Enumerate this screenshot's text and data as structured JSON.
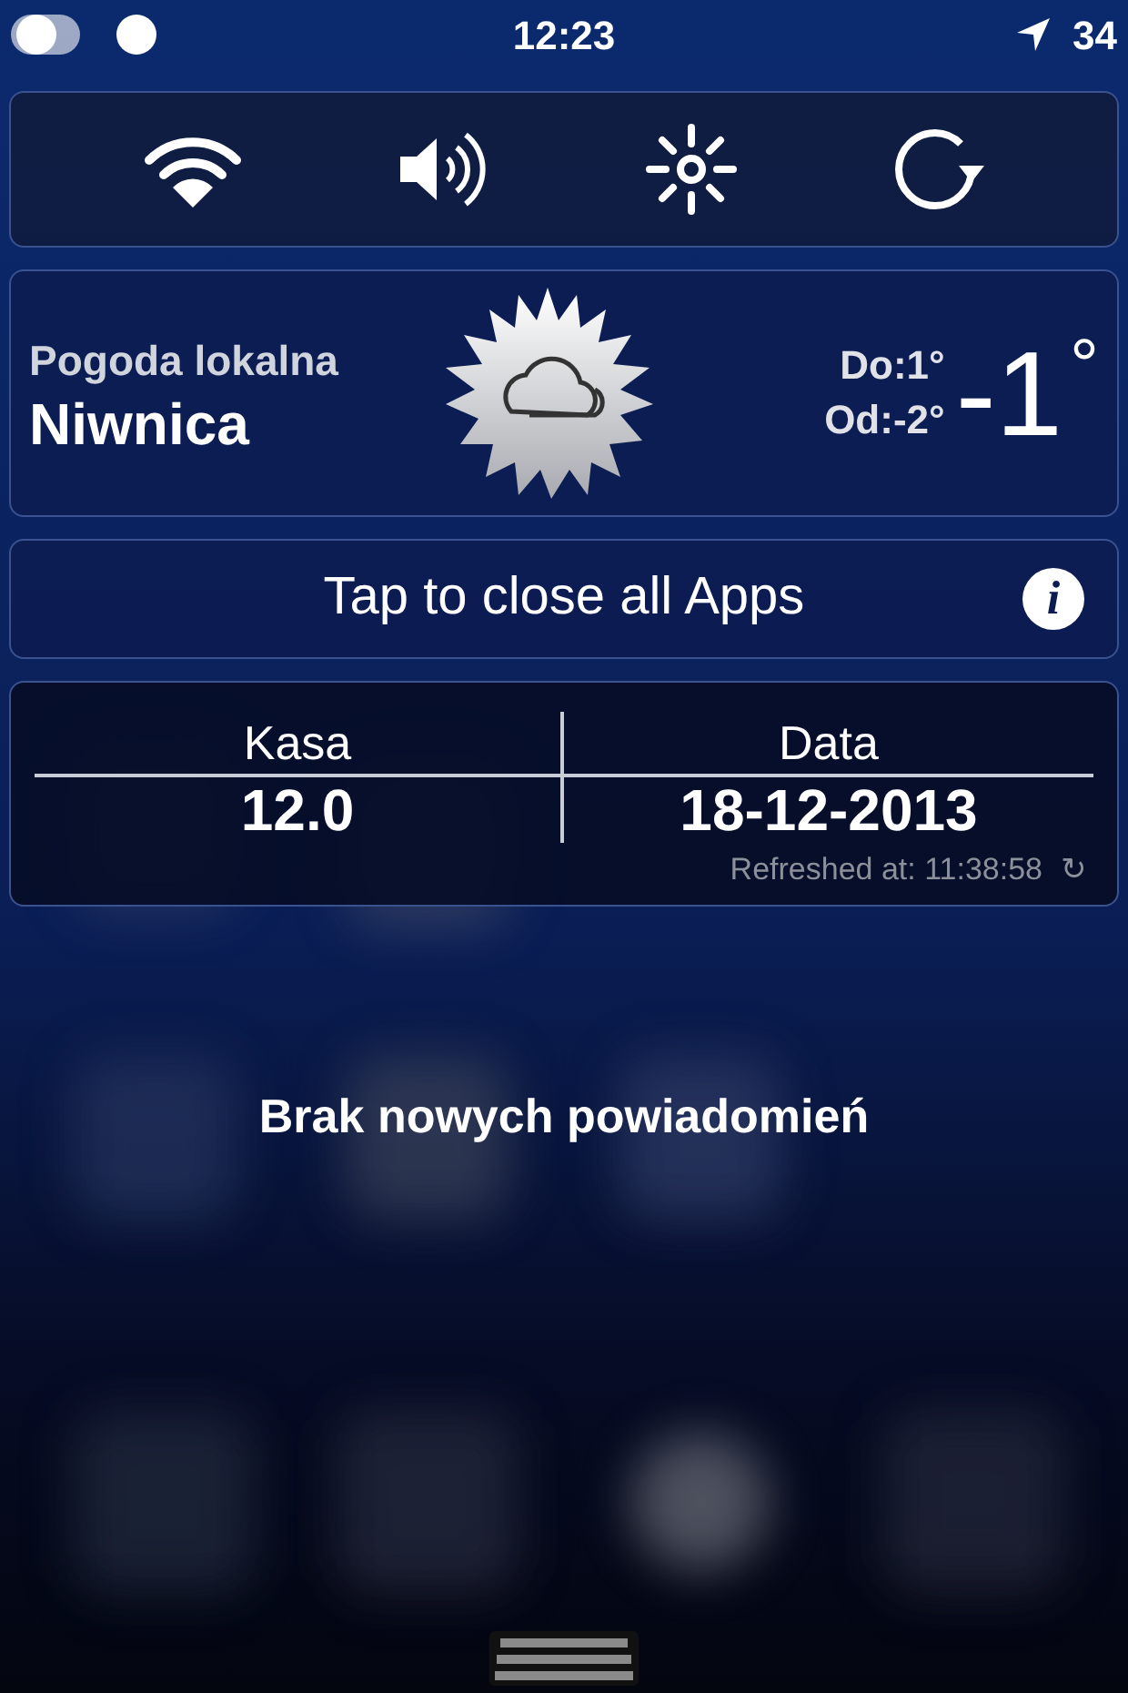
{
  "status_bar": {
    "time": "12:23",
    "battery": "34"
  },
  "toggles": [
    {
      "kind": "wifi"
    },
    {
      "kind": "sound"
    },
    {
      "kind": "brightness"
    },
    {
      "kind": "rotation"
    }
  ],
  "weather": {
    "label": "Pogoda lokalna",
    "city": "Niwnica",
    "high": "Do:1°",
    "low": "Od:-2°",
    "temperature": "-1",
    "temperature_unit": "°"
  },
  "close_apps": {
    "label": "Tap to close all Apps",
    "info": "i"
  },
  "table": {
    "columns": [
      "Kasa",
      "Data"
    ],
    "values": [
      "12.0",
      "18-12-2013"
    ],
    "refreshed": "Refreshed at: 11:38:58",
    "refresh_icon": "↻"
  },
  "notice": "Brak nowych powiadomień"
}
